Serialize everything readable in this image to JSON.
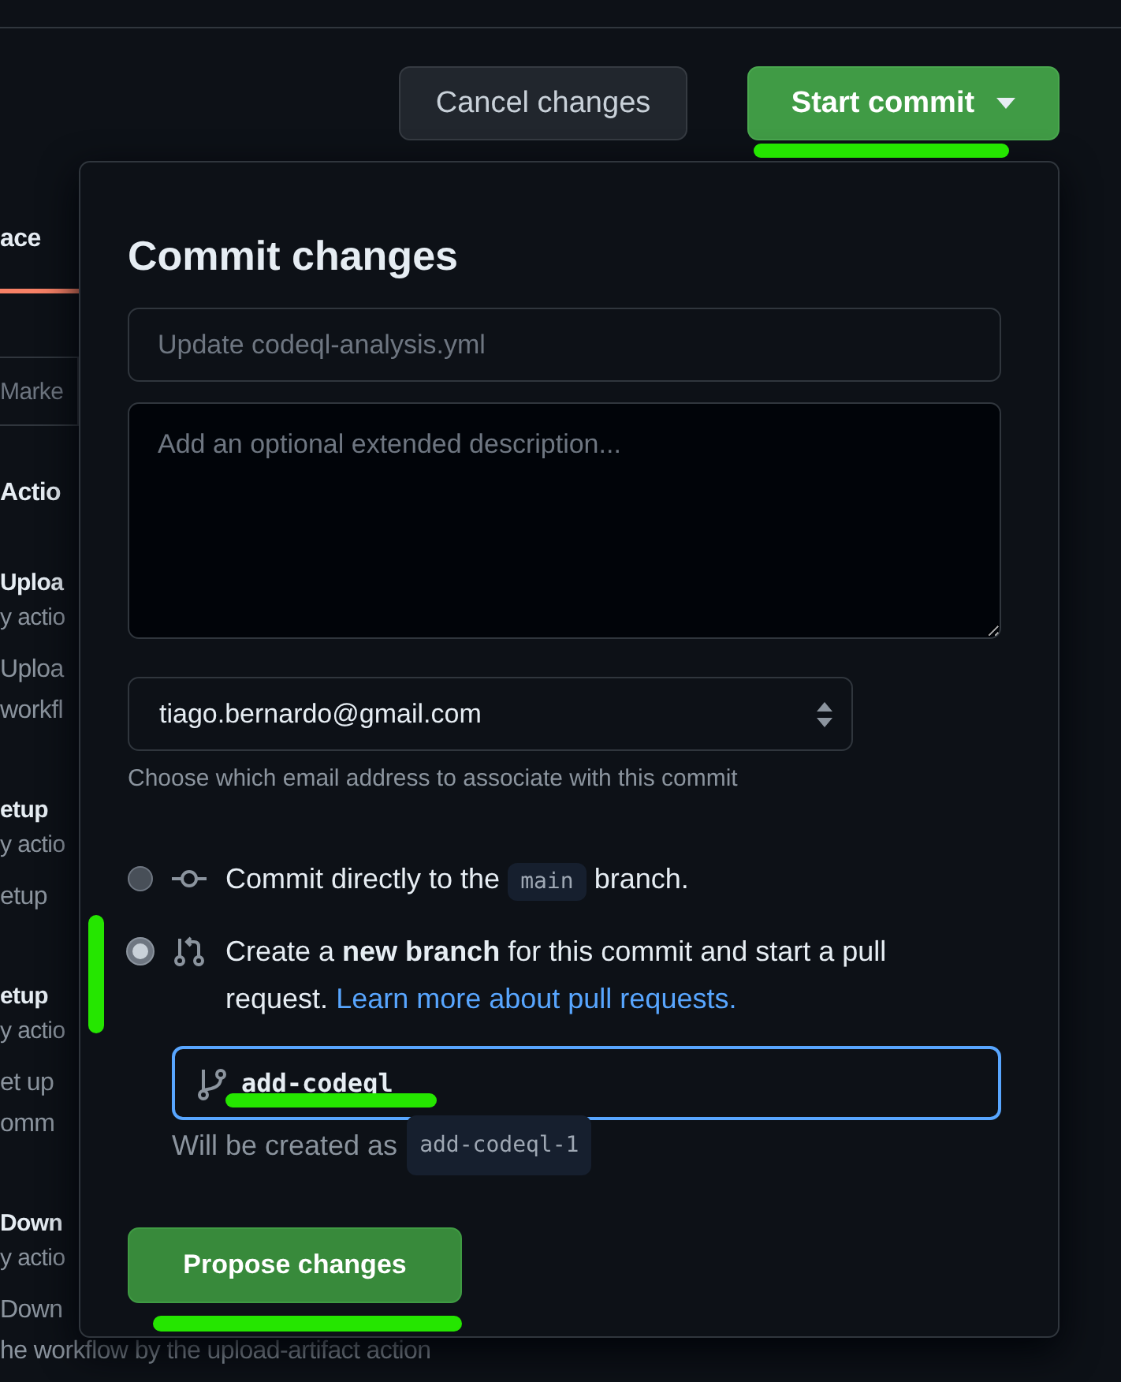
{
  "background_page": {
    "tab": {
      "label": "ace",
      "selected": true
    },
    "search": {
      "placeholder": "Marke"
    },
    "section_title": "Actio",
    "actions": [
      {
        "name": "Uploa",
        "byline": "y actio",
        "description": [
          "Uploa",
          "workfl"
        ]
      },
      {
        "name": "etup",
        "byline": "y actio",
        "description": [
          "etup"
        ]
      },
      {
        "name": "etup",
        "byline": "y actio",
        "description": [
          "et up",
          "omm"
        ]
      },
      {
        "name": "Down",
        "byline": "y actio",
        "description": [
          "Down",
          "he workflow by the upload-artifact action"
        ]
      }
    ]
  },
  "toolbar": {
    "buttons": [
      {
        "label": "Cancel changes",
        "kind": "secondary"
      },
      {
        "label": "Start commit",
        "kind": "primary_dropdown"
      }
    ]
  },
  "commit_dialog": {
    "title": "Commit changes",
    "summary": {
      "placeholder": "Update codeql-analysis.yml"
    },
    "description": {
      "placeholder": "Add an optional extended description..."
    },
    "email": {
      "value": "tiago.bernardo@gmail.com",
      "hint": "Choose which email address to associate with this commit"
    },
    "options": [
      {
        "kind": "direct",
        "selected": false,
        "before": "Commit directly to the",
        "code": "main",
        "after": "branch."
      },
      {
        "kind": "new_branch",
        "selected": true,
        "text": "Create a **new branch** for this commit and start a pull request.",
        "link": "Learn more about pull requests.",
        "branch_field": {
          "value": "add-codeql"
        },
        "note": "Will be created as",
        "note_code": "add-codeql-1"
      }
    ],
    "submit": "Propose changes"
  }
}
